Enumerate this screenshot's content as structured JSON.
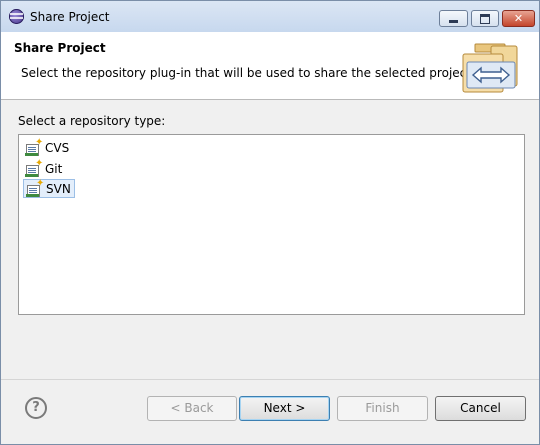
{
  "window": {
    "title": "Share Project",
    "icon": "eclipse-icon"
  },
  "header": {
    "title": "Share Project",
    "description": "Select the repository plug-in that will be used to share the selected project."
  },
  "main": {
    "list_label": "Select a repository type:",
    "repository_types": [
      {
        "label": "CVS",
        "selected": false
      },
      {
        "label": "Git",
        "selected": false
      },
      {
        "label": "SVN",
        "selected": true
      }
    ]
  },
  "footer": {
    "back_label": "< Back",
    "next_label": "Next >",
    "finish_label": "Finish",
    "cancel_label": "Cancel",
    "help_glyph": "?"
  }
}
